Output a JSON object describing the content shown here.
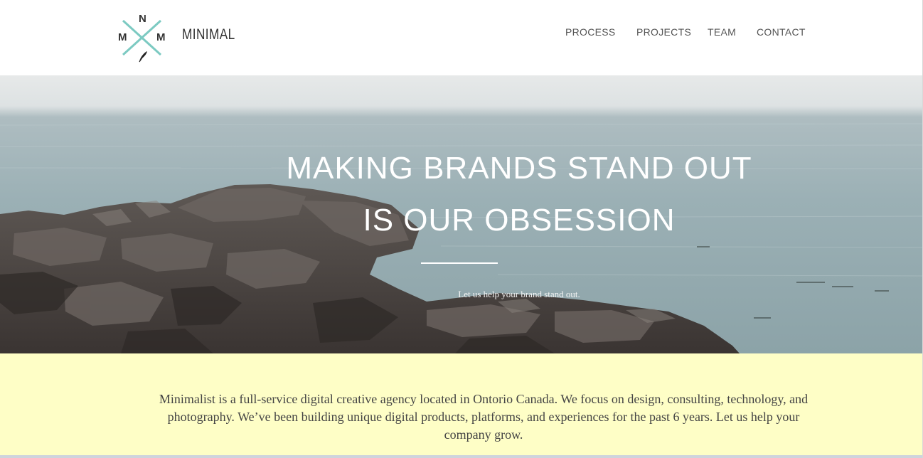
{
  "brand": {
    "letters": {
      "top": "N",
      "left": "M",
      "right": "M"
    },
    "name": "MINIMAL",
    "accent_color": "#7ccac2"
  },
  "nav": {
    "items": [
      {
        "label": "PROCESS"
      },
      {
        "label": "PROJECTS"
      },
      {
        "label": "TEAM"
      },
      {
        "label": "CONTACT"
      }
    ]
  },
  "hero": {
    "title_line1": "MAKING BRANDS STAND OUT",
    "title_line2": "IS OUR OBSESSION",
    "subtitle": "Let us help your brand stand out."
  },
  "about": {
    "text": "Minimalist is a full-service digital creative agency located in Ontorio Canada. We focus on design, consulting, technology, and photography. We’ve been building unique digital products, platforms, and experiences for the past 6 years. Let us help your company grow.",
    "background_color": "#fefec6"
  }
}
